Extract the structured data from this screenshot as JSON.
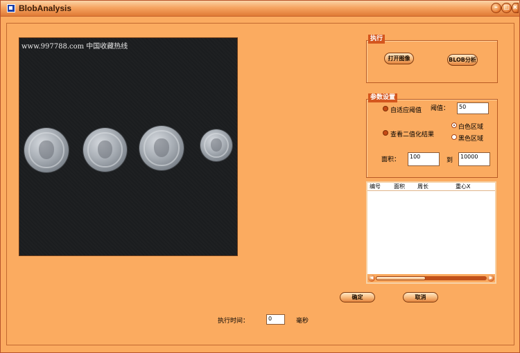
{
  "window": {
    "title": "BlobAnalysis"
  },
  "image": {
    "watermark": "www.997788.com 中国收藏热线"
  },
  "execute": {
    "group_label": "执行",
    "open_image_label": "打开图像",
    "blob_analysis_label": "BLOB分析"
  },
  "params": {
    "group_label": "参数设置",
    "adaptive_threshold_label": "自适应阈值",
    "threshold_label": "阈值：",
    "threshold_value": "50",
    "view_binary_label": "查看二值化结果",
    "white_region_label": "白色区域",
    "black_region_label": "黑色区域",
    "area_label": "面积：",
    "area_min": "100",
    "to_label": "到",
    "area_max": "10000"
  },
  "results_table": {
    "columns": [
      "编号",
      "面积",
      "周长",
      "重心X"
    ]
  },
  "buttons": {
    "ok_label": "确定",
    "cancel_label": "取消"
  },
  "timing": {
    "label": "执行时间：",
    "value": "0",
    "unit": "毫秒"
  },
  "colors": {
    "background": "#fbab60",
    "accent": "#d4561e",
    "image_bg": "#1b1d1f"
  },
  "icons": [
    "app-icon",
    "minimize-icon",
    "maximize-icon",
    "close-icon",
    "scroll-left-icon",
    "scroll-right-icon"
  ]
}
